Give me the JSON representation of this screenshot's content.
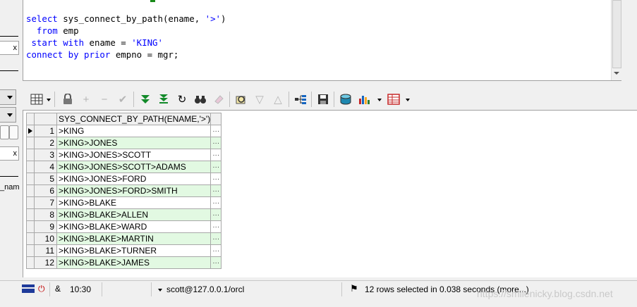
{
  "sidebar": {
    "close_glyph": "x",
    "partial_label": "_nam"
  },
  "editor": {
    "lines": [
      [
        {
          "t": "select",
          "c": "kw"
        },
        {
          "t": " sys_connect_by_path(ename, ",
          "c": "tx"
        },
        {
          "t": "'>'",
          "c": "st"
        },
        {
          "t": ")",
          "c": "tx"
        }
      ],
      [
        {
          "t": "  from",
          "c": "kw"
        },
        {
          "t": " emp",
          "c": "tx"
        }
      ],
      [
        {
          "t": " start with",
          "c": "kw"
        },
        {
          "t": " ename = ",
          "c": "tx"
        },
        {
          "t": "'KING'",
          "c": "st"
        }
      ],
      [
        {
          "t": "connect by prior",
          "c": "kw"
        },
        {
          "t": " empno = mgr;",
          "c": "tx"
        }
      ]
    ]
  },
  "toolbar": {
    "icons": [
      "grid-select-icon",
      "lock-icon",
      "add-row-icon",
      "delete-row-icon",
      "post-check-icon",
      "fetch-next-icon",
      "fetch-last-icon",
      "refresh-icon",
      "search-binoculars-icon",
      "clear-eraser-icon",
      "query-by-example-icon",
      "filter-down-icon",
      "filter-up-icon",
      "plan-tree-icon",
      "save-icon",
      "export-db-icon",
      "chart-icon",
      "table-view-icon"
    ]
  },
  "grid": {
    "column_header": "SYS_CONNECT_BY_PATH(ENAME,'>')",
    "cell_button": "···",
    "rows": [
      {
        "n": "1",
        "path": ">KING"
      },
      {
        "n": "2",
        "path": ">KING>JONES"
      },
      {
        "n": "3",
        "path": ">KING>JONES>SCOTT"
      },
      {
        "n": "4",
        "path": ">KING>JONES>SCOTT>ADAMS"
      },
      {
        "n": "5",
        "path": ">KING>JONES>FORD"
      },
      {
        "n": "6",
        "path": ">KING>JONES>FORD>SMITH"
      },
      {
        "n": "7",
        "path": ">KING>BLAKE"
      },
      {
        "n": "8",
        "path": ">KING>BLAKE>ALLEN"
      },
      {
        "n": "9",
        "path": ">KING>BLAKE>WARD"
      },
      {
        "n": "10",
        "path": ">KING>BLAKE>MARTIN"
      },
      {
        "n": "11",
        "path": ">KING>BLAKE>TURNER"
      },
      {
        "n": "12",
        "path": ">KING>BLAKE>JAMES"
      }
    ],
    "selected_row": 1
  },
  "status": {
    "position": "10:30",
    "connection": "scott@127.0.0.1/orcl",
    "message": "12 rows selected in 0.038 seconds (more...)",
    "watermark": "https://smilenicky.blog.csdn.net"
  },
  "colors": {
    "keyword": "#0000ff",
    "alt_row": "#e2f9e2"
  }
}
